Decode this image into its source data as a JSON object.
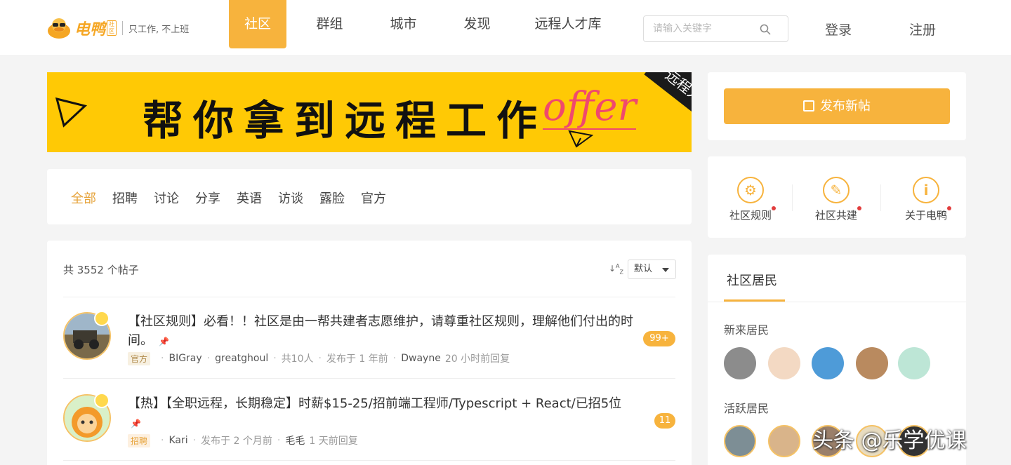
{
  "header": {
    "logo_text": "电鸭",
    "logo_badge": "社区",
    "slogan": "只工作, 不上班",
    "nav": [
      {
        "label": "社区",
        "active": true
      },
      {
        "label": "群组",
        "active": false
      },
      {
        "label": "城市",
        "active": false
      },
      {
        "label": "发现",
        "active": false
      },
      {
        "label": "远程人才库",
        "active": false
      }
    ],
    "search_placeholder": "请输入关键字",
    "login_label": "登录",
    "register_label": "注册"
  },
  "banner": {
    "headline": "帮你拿到远程工作",
    "offer": "offer",
    "ribbon": "远程人才库"
  },
  "filters": [
    "全部",
    "招聘",
    "讨论",
    "分享",
    "英语",
    "访谈",
    "露脸",
    "官方"
  ],
  "filters_active": "全部",
  "posts": {
    "count_text": "共 3552 个帖子",
    "sort_icon": "sort-az-icon",
    "sort_value": "默认",
    "items": [
      {
        "title": "【社区规则】必看！！社区是由一帮共建者志愿维护，请尊重社区规则，理解他们付出的时间。",
        "tag": "官方",
        "author": "BIGray",
        "coauthor": "greatghoul",
        "participants": "共10人",
        "posted": "发布于 1 年前",
        "last_replier": "Dwayne",
        "last_reply_time": "20 小时前回复",
        "reply_count": "99+"
      },
      {
        "title": "【热】【全职远程，长期稳定】时薪$15-25/招前端工程师/Typescript + React/已招5位",
        "tag": "招聘",
        "author": "Kari",
        "posted": "发布于 2 个月前",
        "last_replier": "毛毛",
        "last_reply_time": "1 天前回复",
        "reply_count": "11"
      }
    ]
  },
  "sidebar": {
    "publish_label": "发布新帖",
    "quick_links": [
      {
        "label": "社区规则",
        "icon": "gear-chat-icon"
      },
      {
        "label": "社区共建",
        "icon": "duckling-icon"
      },
      {
        "label": "关于电鸭",
        "icon": "info-icon"
      }
    ],
    "residents_title": "社区居民",
    "new_residents_heading": "新来居民",
    "active_residents_heading": "活跃居民"
  },
  "watermark": "头条 @乐学优课",
  "colors": {
    "accent": "#f7b33d",
    "banner_bg": "#ffc905",
    "offer": "#f0486e",
    "page_bg": "#f4f4f4"
  }
}
